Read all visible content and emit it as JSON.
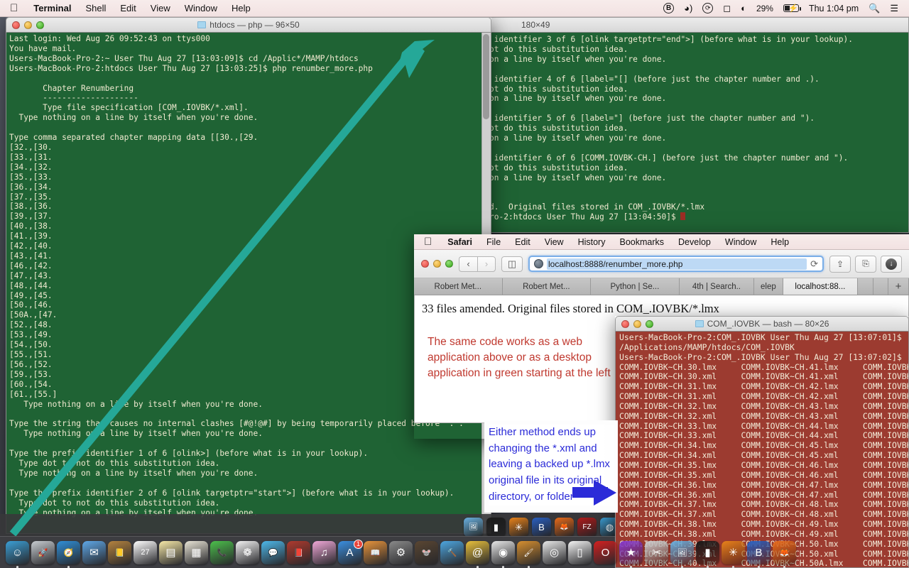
{
  "menubar": {
    "apple": "",
    "items": [
      {
        "label": "Terminal",
        "bold": true
      },
      {
        "label": "Shell",
        "bold": false
      },
      {
        "label": "Edit",
        "bold": false
      },
      {
        "label": "View",
        "bold": false
      },
      {
        "label": "Window",
        "bold": false
      },
      {
        "label": "Help",
        "bold": false
      }
    ],
    "status": {
      "bluetooth_icon": "B",
      "airdrop_icon": "airplay-icon",
      "sync_icon": "spiral-icon",
      "display_icon": "airplay-icon",
      "wifi_icon": "wifi-icon",
      "battery_percent": "29%",
      "clock": "Thu 1:04 pm",
      "search_icon": "search-icon",
      "notification_icon": "list-icon"
    }
  },
  "terminal_green": {
    "title": "htdocs — php — 96×50",
    "lines": [
      "Last login: Wed Aug 26 09:52:43 on ttys000",
      "You have mail.",
      "Users-MacBook-Pro-2:~ User Thu Aug 27 [13:03:09]$ cd /Applic*/MAMP/htdocs",
      "Users-MacBook-Pro-2:htdocs User Thu Aug 27 [13:03:25]$ php renumber_more.php",
      "",
      "       Chapter Renumbering",
      "       --------------------",
      "       Type file specification [COM_.IOVBK/*.xml].",
      "  Type nothing on a line by itself when you're done.",
      "",
      "Type comma separated chapter mapping data [[30.,[29.",
      "[32.,[30.",
      "[33.,[31.",
      "[34.,[32.",
      "[35.,[33.",
      "[36.,[34.",
      "[37.,[35.",
      "[38.,[36.",
      "[39.,[37.",
      "[40.,[38.",
      "[41.,[39.",
      "[42.,[40.",
      "[43.,[41.",
      "[46.,[42.",
      "[47.,[43.",
      "[48.,[44.",
      "[49.,[45.",
      "[50.,[46.",
      "[50A.,[47.",
      "[52.,[48.",
      "[53.,[49.",
      "[54.,[50.",
      "[55.,[51.",
      "[56.,[52.",
      "[59.,[53.",
      "[60.,[54.",
      "[61.,[55.]",
      "   Type nothing on a line by itself when you're done.",
      "",
      "Type the string that causes no internal clashes [#@!@#] by being temporarily placed before '.'.",
      "   Type nothing on a line by itself when you're done.",
      "",
      "Type the prefix identifier 1 of 6 [olink>] (before what is in your lookup).",
      "  Type dot to not do this substitution idea.",
      "  Type nothing on a line by itself when you're done.",
      "",
      "Type the prefix identifier 2 of 6 [olink targetptr=\"start\">] (before what is in your lookup).",
      "  Type dot to not do this substitution idea.",
      "  Type nothing on a line by itself when you're done."
    ]
  },
  "terminal_green_back": {
    "title": "180×49",
    "lines": [
      "Type the prefix identifier 3 of 6 [olink targetptr=\"end\">] (before what is in your lookup).",
      "  Type dot to not do this substitution idea.",
      "  Type nothing on a line by itself when you're done.",
      "",
      "Type the prefix identifier 4 of 6 [label=\"[] (before just the chapter number and .).",
      "  Type dot to not do this substitution idea.",
      "  Type nothing on a line by itself when you're done.",
      "",
      "Type the prefix identifier 5 of 6 [label=\"] (before just the chapter number and \").",
      "  Type dot to not do this substitution idea.",
      "  Type nothing on a line by itself when you're done.",
      "",
      "Type the prefix identifier 6 of 6 [COMM.IOVBK-CH.] (before just the chapter number and \").",
      "  Type dot to not do this substitution idea.",
      "  Type nothing on a line by itself when you're done.",
      "",
      "",
      "33 files amended.  Original files stored in COM_.IOVBK/*.lmx"
    ],
    "prompt": "Users-MacBook-Pro-2:htdocs User Thu Aug 27 [13:04:50]$ "
  },
  "safari": {
    "menubar": [
      {
        "label": "Safari",
        "bold": true
      },
      {
        "label": "File",
        "bold": false
      },
      {
        "label": "Edit",
        "bold": false
      },
      {
        "label": "View",
        "bold": false
      },
      {
        "label": "History",
        "bold": false
      },
      {
        "label": "Bookmarks",
        "bold": false
      },
      {
        "label": "Develop",
        "bold": false
      },
      {
        "label": "Window",
        "bold": false
      },
      {
        "label": "Help",
        "bold": false
      }
    ],
    "back_icon": "chevron-left-icon",
    "forward_icon": "chevron-right-icon",
    "sidebar_icon": "sidebar-icon",
    "globe_icon": "globe-icon",
    "url": "localhost:8888/renumber_more.php",
    "reload_icon": "reload-icon",
    "share_icon": "share-icon",
    "tabs_overview_icon": "tabs-icon",
    "downloads_icon": "download-icon",
    "tabs": [
      {
        "label": "Robert Met...",
        "active": false
      },
      {
        "label": "Robert Met...",
        "active": false
      },
      {
        "label": "Python | Se...",
        "active": false
      },
      {
        "label": "4th | Search..",
        "active": false
      },
      {
        "label": "elep",
        "active": false
      },
      {
        "label": "localhost:88...",
        "active": true
      }
    ],
    "new_tab_icon": "plus-icon",
    "page_result": "33 files amended. Original files stored in COM_.IOVBK/*.lmx"
  },
  "annotations": {
    "red_note": "The same code works as a web application above or as a desktop application in green starting at the left",
    "red_color": "#c0392f",
    "blue_note": "Either method ends up changing the *.xml and leaving a backed up *.lmx original file in its original directory, or folder",
    "blue_color": "#2b2bd8",
    "teal_arrow_color": "#25a898"
  },
  "terminal_red": {
    "title": "COM_.IOVBK — bash — 80×26",
    "header_lines": [
      "Users-MacBook-Pro-2:COM_.IOVBK User Thu Aug 27 [13:07:01]$",
      "/Applications/MAMP/htdocs/COM_.IOVBK",
      "Users-MacBook-Pro-2:COM_.IOVBK User Thu Aug 27 [13:07:02]$"
    ],
    "file_rows": [
      [
        "COMM.IOVBK~CH.30.lmx",
        "COMM.IOVBK~CH.41.lmx",
        "COMM.IOVBK"
      ],
      [
        "COMM.IOVBK~CH.30.xml",
        "COMM.IOVBK~CH.41.xml",
        "COMM.IOVBK"
      ],
      [
        "COMM.IOVBK~CH.31.lmx",
        "COMM.IOVBK~CH.42.lmx",
        "COMM.IOVBK"
      ],
      [
        "COMM.IOVBK~CH.31.xml",
        "COMM.IOVBK~CH.42.xml",
        "COMM.IOVBK"
      ],
      [
        "COMM.IOVBK~CH.32.lmx",
        "COMM.IOVBK~CH.43.lmx",
        "COMM.IOVBK"
      ],
      [
        "COMM.IOVBK~CH.32.xml",
        "COMM.IOVBK~CH.43.xml",
        "COMM.IOVBK"
      ],
      [
        "COMM.IOVBK~CH.33.lmx",
        "COMM.IOVBK~CH.44.lmx",
        "COMM.IOVBK"
      ],
      [
        "COMM.IOVBK~CH.33.xml",
        "COMM.IOVBK~CH.44.xml",
        "COMM.IOVBK"
      ],
      [
        "COMM.IOVBK~CH.34.lmx",
        "COMM.IOVBK~CH.45.lmx",
        "COMM.IOVBK"
      ],
      [
        "COMM.IOVBK~CH.34.xml",
        "COMM.IOVBK~CH.45.xml",
        "COMM.IOVBK"
      ],
      [
        "COMM.IOVBK~CH.35.lmx",
        "COMM.IOVBK~CH.46.lmx",
        "COMM.IOVBK"
      ],
      [
        "COMM.IOVBK~CH.35.xml",
        "COMM.IOVBK~CH.46.xml",
        "COMM.IOVBK"
      ],
      [
        "COMM.IOVBK~CH.36.lmx",
        "COMM.IOVBK~CH.47.lmx",
        "COMM.IOVBK"
      ],
      [
        "COMM.IOVBK~CH.36.xml",
        "COMM.IOVBK~CH.47.xml",
        "COMM.IOVBK"
      ],
      [
        "COMM.IOVBK~CH.37.lmx",
        "COMM.IOVBK~CH.48.lmx",
        "COMM.IOVBK"
      ],
      [
        "COMM.IOVBK~CH.37.xml",
        "COMM.IOVBK~CH.48.xml",
        "COMM.IOVBK"
      ],
      [
        "COMM.IOVBK~CH.38.lmx",
        "COMM.IOVBK~CH.49.lmx",
        "COMM.IOVBK"
      ],
      [
        "COMM.IOVBK~CH.38.xml",
        "COMM.IOVBK~CH.49.xml",
        "COMM.IOVBK"
      ],
      [
        "COMM.IOVBK~CH.39.lmx",
        "COMM.IOVBK~CH.50.lmx",
        "COMM.IOVBK"
      ],
      [
        "COMM.IOVBK~CH.39.xml",
        "COMM.IOVBK~CH.50.xml",
        "COMM.IOVBK"
      ],
      [
        "COMM.IOVBK~CH.40.lmx",
        "COMM.IOVBK~CH.50A.lmx",
        "COMM.IOVBK"
      ]
    ]
  },
  "dock": {
    "items": [
      {
        "name": "finder",
        "glyph": "☺",
        "color": "#3b9fd6",
        "running": true
      },
      {
        "name": "launchpad",
        "glyph": "🚀",
        "color": "#c8cdd2",
        "running": false
      },
      {
        "name": "safari",
        "glyph": "🧭",
        "color": "#2f8fd8",
        "running": true
      },
      {
        "name": "mail",
        "glyph": "✉",
        "color": "#5fa8e8",
        "running": false
      },
      {
        "name": "contacts",
        "glyph": "📒",
        "color": "#b5833f",
        "running": false
      },
      {
        "name": "calendar",
        "glyph": "27",
        "color": "#ffffff",
        "running": false
      },
      {
        "name": "notes",
        "glyph": "▤",
        "color": "#f7e9a8",
        "running": false
      },
      {
        "name": "news",
        "glyph": "▦",
        "color": "#e8e4d6",
        "running": false
      },
      {
        "name": "facetime",
        "glyph": "📞",
        "color": "#4cc04c",
        "running": false
      },
      {
        "name": "photos",
        "glyph": "❁",
        "color": "#f2f2f2",
        "running": false
      },
      {
        "name": "messages",
        "glyph": "💬",
        "color": "#4db8ea",
        "running": false
      },
      {
        "name": "dictionary",
        "glyph": "📕",
        "color": "#b03a2e",
        "running": false
      },
      {
        "name": "itunes",
        "glyph": "♫",
        "color": "#f0a8d8",
        "running": false
      },
      {
        "name": "app-store",
        "glyph": "A",
        "color": "#3b8fe0",
        "running": false,
        "badge": "1"
      },
      {
        "name": "ibooks",
        "glyph": "📖",
        "color": "#e8943c",
        "running": false
      },
      {
        "name": "system-preferences",
        "glyph": "⚙",
        "color": "#8a8a8a",
        "running": false
      },
      {
        "name": "gimp",
        "glyph": "🐭",
        "color": "#5a4632",
        "running": false
      },
      {
        "name": "tools",
        "glyph": "🔨",
        "color": "#4da6e0",
        "running": false
      },
      {
        "name": "skim",
        "glyph": "@",
        "color": "#e8c03c",
        "running": true
      },
      {
        "name": "oxygen",
        "glyph": "◉",
        "color": "#e8e8e8",
        "running": true
      },
      {
        "name": "paint",
        "glyph": "🖌",
        "color": "#d89030",
        "running": true
      },
      {
        "name": "chrome",
        "glyph": "◎",
        "color": "#e8e8e8",
        "running": false
      },
      {
        "name": "textedit",
        "glyph": "▯",
        "color": "#f4f4f4",
        "running": false
      },
      {
        "name": "opera",
        "glyph": "O",
        "color": "#d42020",
        "running": false
      },
      {
        "name": "imovie",
        "glyph": "★",
        "color": "#8a3ad0",
        "running": true
      },
      {
        "name": "scissors",
        "glyph": "✂",
        "color": "#cfcfcf",
        "running": false
      },
      {
        "name": "preview",
        "glyph": "🖼",
        "color": "#6ab0e0",
        "running": true
      },
      {
        "name": "terminal",
        "glyph": "▮",
        "color": "#1a1a1a",
        "running": true
      },
      {
        "name": "avast",
        "glyph": "✳",
        "color": "#e8821a",
        "running": true
      },
      {
        "name": "bbedit",
        "glyph": "B",
        "color": "#2a5fc0",
        "running": true
      },
      {
        "name": "firefox",
        "glyph": "🦊",
        "color": "#e86a1a",
        "running": true
      }
    ],
    "back_items": [
      {
        "name": "preview-back",
        "glyph": "🖼",
        "color": "#6ab0e0"
      },
      {
        "name": "terminal-back",
        "glyph": "▮",
        "color": "#1a1a1a"
      },
      {
        "name": "avast-back",
        "glyph": "✳",
        "color": "#e8821a"
      },
      {
        "name": "bbedit-back",
        "glyph": "B",
        "color": "#2a5fc0"
      },
      {
        "name": "firefox-back",
        "glyph": "🦊",
        "color": "#e86a1a"
      },
      {
        "name": "filezilla-back",
        "glyph": "FZ",
        "color": "#b01a1a"
      },
      {
        "name": "extra-back",
        "glyph": "◍",
        "color": "#3b9fd6"
      }
    ]
  }
}
